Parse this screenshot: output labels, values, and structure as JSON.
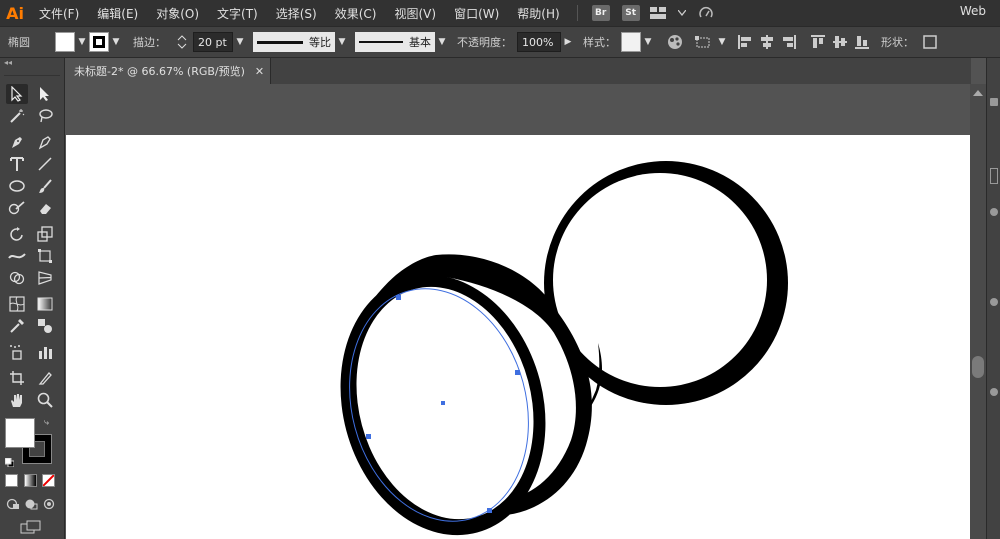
{
  "app": {
    "logo": "Ai",
    "workspace": "Web"
  },
  "menu": [
    {
      "label": "文件(F)"
    },
    {
      "label": "编辑(E)"
    },
    {
      "label": "对象(O)"
    },
    {
      "label": "文字(T)"
    },
    {
      "label": "选择(S)"
    },
    {
      "label": "效果(C)"
    },
    {
      "label": "视图(V)"
    },
    {
      "label": "窗口(W)"
    },
    {
      "label": "帮助(H)"
    }
  ],
  "menubar_badges": {
    "bridge": "Br",
    "stock": "St"
  },
  "control": {
    "object_type": "椭圆",
    "stroke_label": "描边：",
    "stroke_weight": "20 pt",
    "profile_label": "等比",
    "brush_label": "基本",
    "opacity_label": "不透明度：",
    "opacity_value": "100%",
    "style_label": "样式：",
    "shape_label": "形状："
  },
  "document": {
    "tab_title": "未标题-2* @ 66.67% (RGB/预览)",
    "close_glyph": "✕"
  },
  "colors": {
    "fill": "#ffffff",
    "stroke": "#000000",
    "selection": "#3f6fe0"
  }
}
